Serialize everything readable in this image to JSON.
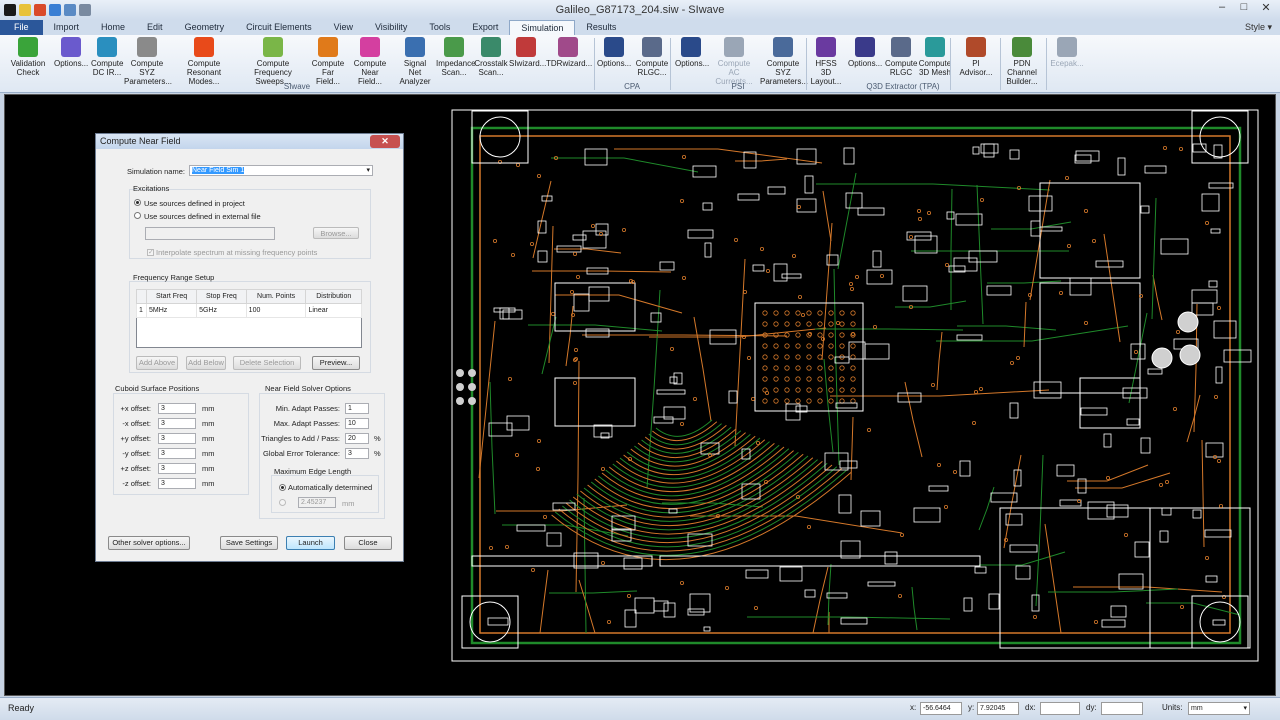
{
  "app": {
    "title": "Galileo_G87173_204.siw - SIwave",
    "style_label": "Style"
  },
  "tabs": [
    "File",
    "Import",
    "Home",
    "Edit",
    "Geometry",
    "Circuit Elements",
    "View",
    "Visibility",
    "Tools",
    "Export",
    "Simulation",
    "Results"
  ],
  "ribbon": {
    "buttons": [
      {
        "label": "Validation Check",
        "color": "#3aa43a"
      },
      {
        "label": "Options...",
        "color": "#6a5acd"
      },
      {
        "label": "Compute DC IR...",
        "color": "#2a8fbf"
      },
      {
        "label": "Compute SYZ Parameters...",
        "color": "#8a8a8a"
      },
      {
        "label": "Compute Resonant Modes...",
        "color": "#e84a1a"
      },
      {
        "label": "Compute Frequency Sweeps...",
        "color": "#7ab648"
      },
      {
        "label": "Compute Far Field...",
        "color": "#e07a1a"
      },
      {
        "label": "Compute Near Field...",
        "color": "#d43fa0"
      },
      {
        "label": "Signal Net Analyzer",
        "color": "#3a6fb0"
      },
      {
        "label": "Impedance Scan...",
        "color": "#4a9a4a"
      },
      {
        "label": "Crosstalk Scan...",
        "color": "#3a8a6a"
      },
      {
        "label": "SIwizard...",
        "color": "#c03a3a"
      },
      {
        "label": "TDRwizard...",
        "color": "#a04a8a"
      },
      {
        "label": "Options...",
        "color": "#2a4a8a"
      },
      {
        "label": "Compute RLGC...",
        "color": "#5a6a8a"
      },
      {
        "label": "Options...",
        "color": "#2a4a8a"
      },
      {
        "label": "Compute AC Currents...",
        "color": "#9aa6b6"
      },
      {
        "label": "Compute SYZ Parameters...",
        "color": "#4a6a9a"
      },
      {
        "label": "HFSS 3D Layout...",
        "color": "#6a3aa0"
      },
      {
        "label": "Options...",
        "color": "#3a3a8a"
      },
      {
        "label": "Compute RLGC",
        "color": "#5a6a8a"
      },
      {
        "label": "Compute 3D Mesh",
        "color": "#2a9a9a"
      },
      {
        "label": "PI Advisor...",
        "color": "#b04a2a"
      },
      {
        "label": "PDN Channel Builder...",
        "color": "#4a8a3a"
      },
      {
        "label": "Ecepak...",
        "color": "#9aa6b6"
      }
    ],
    "groups": [
      "SIwave",
      "CPA",
      "PSI",
      "Q3D Extractor (TPA)"
    ]
  },
  "dialog": {
    "title": "Compute Near Field",
    "close_label": "✕",
    "simulation_name_label": "Simulation name:",
    "simulation_name_value": "Near Field Sim 1",
    "excitations_label": "Excitations",
    "radio_project": "Use sources defined in project",
    "radio_external": "Use sources defined in external file",
    "browse_label": "Browse...",
    "interpolate_label": "Interpolate spectrum at missing frequency points",
    "freq_range_label": "Frequency Range Setup",
    "table": {
      "headers": [
        "Start Freq",
        "Stop Freq",
        "Num. Points",
        "Distribution"
      ],
      "rows": [
        {
          "index": "1",
          "start": "5MHz",
          "stop": "5GHz",
          "points": "100",
          "dist": "Linear"
        }
      ]
    },
    "add_above": "Add Above",
    "add_below": "Add Below",
    "delete_selection": "Delete Selection",
    "preview": "Preview...",
    "cuboid_label": "Cuboid Surface Positions",
    "offsets": [
      {
        "label": "+x offset:",
        "value": "3",
        "unit": "mm"
      },
      {
        "label": "-x offset:",
        "value": "3",
        "unit": "mm"
      },
      {
        "label": "+y offset:",
        "value": "3",
        "unit": "mm"
      },
      {
        "label": "-y offset:",
        "value": "3",
        "unit": "mm"
      },
      {
        "label": "+z offset:",
        "value": "3",
        "unit": "mm"
      },
      {
        "label": "-z offset:",
        "value": "3",
        "unit": "mm"
      }
    ],
    "solver_label": "Near Field Solver Options",
    "solver": [
      {
        "label": "Min. Adapt Passes:",
        "value": "1",
        "unit": ""
      },
      {
        "label": "Max. Adapt Passes:",
        "value": "10",
        "unit": ""
      },
      {
        "label": "Triangles to Add / Pass:",
        "value": "20",
        "unit": "%"
      },
      {
        "label": "Global Error Tolerance:",
        "value": "3",
        "unit": "%"
      }
    ],
    "max_edge_label": "Maximum Edge Length",
    "auto_label": "Automatically determined",
    "edge_value": "2.45237",
    "edge_unit": "mm",
    "other_options": "Other solver options...",
    "save_settings": "Save Settings",
    "launch": "Launch",
    "close": "Close"
  },
  "status": {
    "ready": "Ready",
    "x_label": "x:",
    "x_value": "-56.6464",
    "y_label": "y:",
    "y_value": "7.92045",
    "dx_label": "dx:",
    "dy_label": "dy:",
    "units_label": "Units:",
    "units_value": "mm"
  },
  "colors": {
    "trace_orange": "#d4782a",
    "trace_green": "#1f8a2a",
    "silkscreen": "#ffffff",
    "background": "#000000"
  }
}
